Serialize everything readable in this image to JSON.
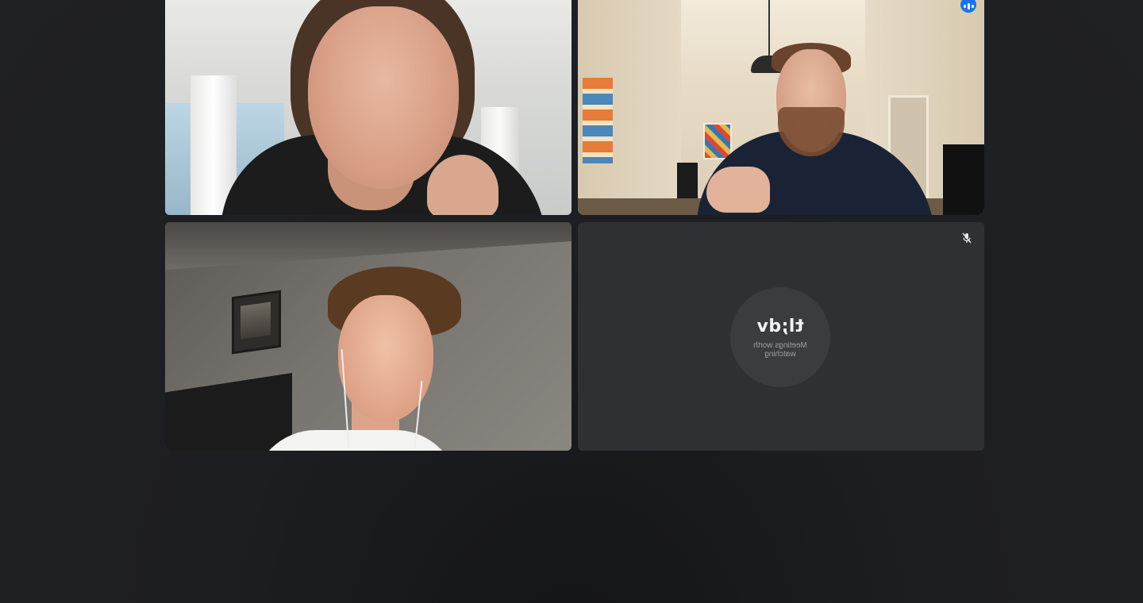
{
  "participants": [
    {
      "name": "",
      "video": "on"
    },
    {
      "name": "",
      "video": "on",
      "speaking": true
    },
    {
      "name": "",
      "video": "on"
    },
    {
      "name": "",
      "video": "off",
      "muted": true
    }
  ],
  "avatar": {
    "logo_text": "tl;dv",
    "tagline": "Meetings worth watching"
  },
  "icons": {
    "speaking": "audio-level-icon",
    "muted": "mic-off-icon"
  },
  "colors": {
    "background": "#202124",
    "active_speaker_border": "#8ab4f8",
    "speaking_badge": "#1a73e8",
    "tile_off": "#2f3034"
  }
}
